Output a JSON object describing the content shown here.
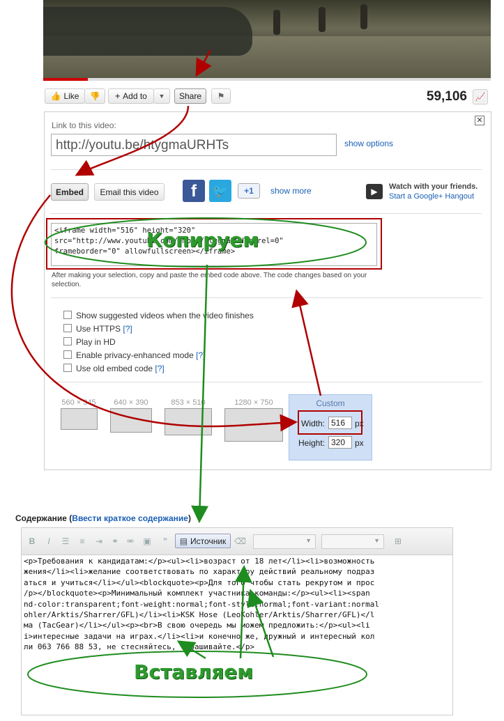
{
  "video": {
    "progress": 0.1
  },
  "toolbar": {
    "like_label": "Like",
    "add_to_label": "Add to",
    "share_label": "Share",
    "view_count": "59,106"
  },
  "share": {
    "link_label": "Link to this video:",
    "link_value": "http://youtu.be/htygmaURHTs",
    "show_options": "show options",
    "embed_label": "Embed",
    "email_label": "Email this video",
    "show_more": "show more",
    "hangout_title": "Watch with your friends.",
    "hangout_link": "Start a Google+ Hangout",
    "google_plus_label": "+1",
    "embed_code": "<iframe width=\"516\" height=\"320\"\nsrc=\"http://www.youtube.com/embed/htygmaURHTs?rel=0\"\nframeborder=\"0\" allowfullscreen></iframe>",
    "embed_note": "After making your selection, copy and paste the embed code above. The code changes based on your selection.",
    "options": [
      {
        "label": "Show suggested videos when the video finishes",
        "help": ""
      },
      {
        "label": "Use HTTPS",
        "help": "[?]"
      },
      {
        "label": "Play in HD",
        "help": ""
      },
      {
        "label": "Enable privacy-enhanced mode",
        "help": "[?]"
      },
      {
        "label": "Use old embed code",
        "help": "[?]"
      }
    ],
    "sizes": [
      "560 × 345",
      "640 × 390",
      "853 × 510",
      "1280 × 750"
    ],
    "custom_label": "Custom",
    "width_label": "Width:",
    "width_value": "516",
    "height_label": "Height:",
    "height_value": "320",
    "unit": "px"
  },
  "editor": {
    "heading": "Содержание",
    "heading_link": "Ввести краткое содержание",
    "source_button": "Источник",
    "content": "<p>Требования к кандидатам:</p><ul><li>возраст от 18 лет</li><li>возможность\nжения</li><li>желание соответствовать по характеру действий реальному подраз\nаться и учиться</li></ul><blockquote><p>Для того чтобы стать рекрутом и прос\n/p></blockquote><p>Минимальный комплект участника команды:</p><ul><li><span \nnd-color:transparent;font-weight:normal;font-style:normal;font-variant:normal\nohler/Arktis/Sharrer/GFL)</li><li>KSK Hose (LeoKohler/Arktis/Sharrer/GFL)</l\nма (TacGear)</li></ul><p><br>В свою очередь мы можем предложить:</p><ul><li\ni>интересные задачи на играх.</li><li>и конечно же, дружный и интересный кол\nли 063 766 88 53, не стесняйтесь, спрашивайте.</p>"
  },
  "annotations": {
    "copy_label": "Копируем",
    "paste_label": "Вставляем",
    "red": "#b00000",
    "green": "#1e8c1e"
  }
}
